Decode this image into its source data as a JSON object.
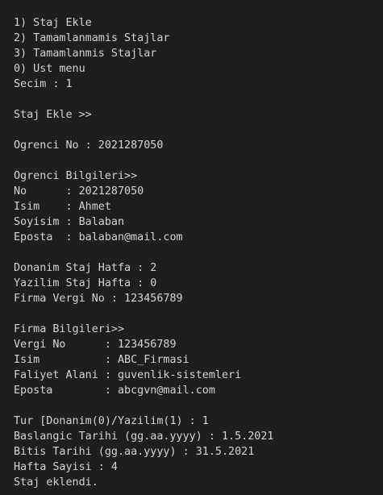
{
  "terminal": {
    "lines": [
      "1) Staj Ekle",
      "2) Tamamlanmamis Stajlar",
      "3) Tamamlanmis Stajlar",
      "0) Ust menu",
      "Secim : 1",
      "",
      "Staj Ekle >>",
      "",
      "Ogrenci No : 2021287050",
      "",
      "Ogrenci Bilgileri>>",
      "No      : 2021287050",
      "Isim    : Ahmet",
      "Soyisim : Balaban",
      "Eposta  : balaban@mail.com",
      "",
      "Donanim Staj Hatfa : 2",
      "Yazilim Staj Hafta : 0",
      "Firma Vergi No : 123456789",
      "",
      "Firma Bilgileri>>",
      "Vergi No      : 123456789",
      "Isim          : ABC_Firmasi",
      "Faliyet Alani : guvenlik-sistemleri",
      "Eposta        : abcgvn@mail.com",
      "",
      "Tur [Donanim(0)/Yazilim(1) : 1",
      "Baslangic Tarihi (gg.aa.yyyy) : 1.5.2021",
      "Bitis Tarihi (gg.aa.yyyy) : 31.5.2021",
      "Hafta Sayisi : 4",
      "Staj eklendi."
    ]
  }
}
